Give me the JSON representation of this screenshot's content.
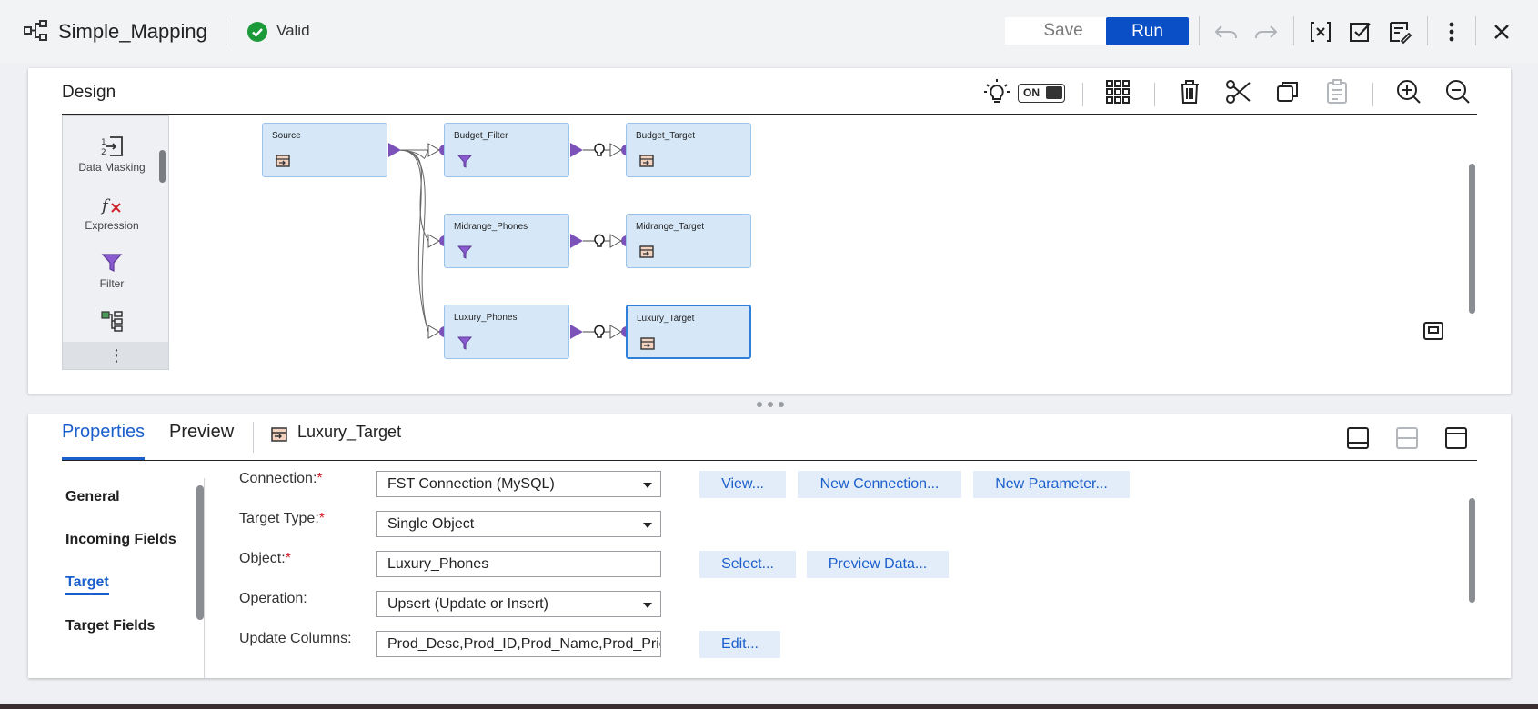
{
  "header": {
    "title": "Simple_Mapping",
    "status": "Valid",
    "save_label": "Save",
    "run_label": "Run",
    "accent": "#0b4fc7",
    "status_color": "#1c9a3a"
  },
  "design": {
    "title": "Design",
    "toggle_label": "ON",
    "palette": [
      {
        "label": "Data Masking",
        "icon": "data-masking-icon"
      },
      {
        "label": "Expression",
        "icon": "expression-icon"
      },
      {
        "label": "Filter",
        "icon": "filter-icon"
      },
      {
        "label": "",
        "icon": "hierarchy-icon"
      }
    ],
    "nodes": {
      "source": "Source",
      "budget_filter": "Budget_Filter",
      "budget_target": "Budget_Target",
      "midrange_phones": "Midrange_Phones",
      "midrange_target": "Midrange_Target",
      "luxury_phones": "Luxury_Phones",
      "luxury_target": "Luxury_Target"
    }
  },
  "properties": {
    "tabs": [
      "Properties",
      "Preview"
    ],
    "selected_object": "Luxury_Target",
    "nav": [
      "General",
      "Incoming Fields",
      "Target",
      "Target Fields"
    ],
    "fields": {
      "connection": {
        "label": "Connection:",
        "value": "FST Connection (MySQL)"
      },
      "target_type": {
        "label": "Target Type:",
        "value": "Single Object"
      },
      "object": {
        "label": "Object:",
        "value": "Luxury_Phones"
      },
      "operation": {
        "label": "Operation:",
        "value": "Upsert (Update or Insert)"
      },
      "update_columns": {
        "label": "Update Columns:",
        "value": "Prod_Desc,Prod_ID,Prod_Name,Prod_Pric"
      }
    },
    "buttons": {
      "view": "View...",
      "new_connection": "New Connection...",
      "new_parameter": "New Parameter...",
      "select": "Select...",
      "preview_data": "Preview Data...",
      "edit": "Edit..."
    }
  }
}
